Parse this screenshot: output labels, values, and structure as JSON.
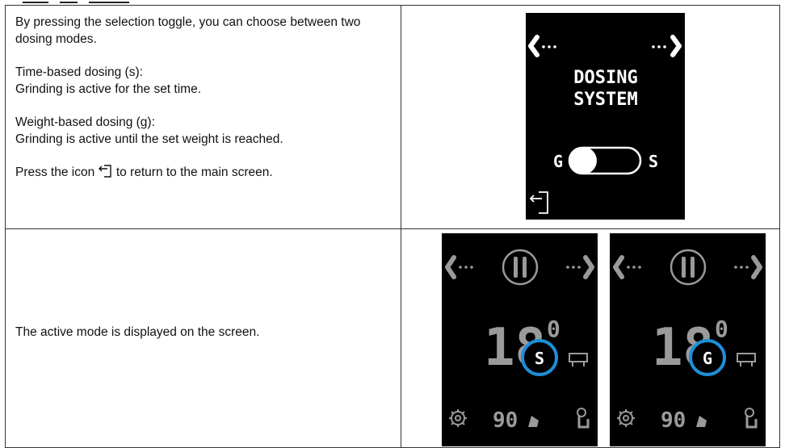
{
  "row1": {
    "intro": "By pressing the selection toggle, you can choose between two dosing modes.",
    "time_mode_title": "Time-based dosing (s):",
    "time_mode_desc": "Grinding is active for the set time.",
    "weight_mode_title": "Weight-based dosing (g):",
    "weight_mode_desc": "Grinding is active until the set weight is reached.",
    "return_text_before": "Press the icon",
    "return_text_after": "to return to the main screen.",
    "screen": {
      "title_line1": "DOSING",
      "title_line2": "SYSTEM",
      "toggle_left": "G",
      "toggle_right": "S",
      "nav_left_icon": "chevron-left-dots-icon",
      "nav_right_icon": "dots-chevron-right-icon",
      "exit_icon": "exit-icon"
    }
  },
  "row2": {
    "description": "The active mode is displayed on the screen.",
    "screens": [
      {
        "main_value": "18",
        "decimal": "0",
        "mode": "S",
        "bottom_value": "90"
      },
      {
        "main_value": "18",
        "decimal": "0",
        "mode": "G",
        "bottom_value": "90"
      }
    ]
  },
  "colors": {
    "screen_bg": "#000000",
    "highlight_ring": "#1e8ed8",
    "dim_gray": "#9a9a9a"
  }
}
